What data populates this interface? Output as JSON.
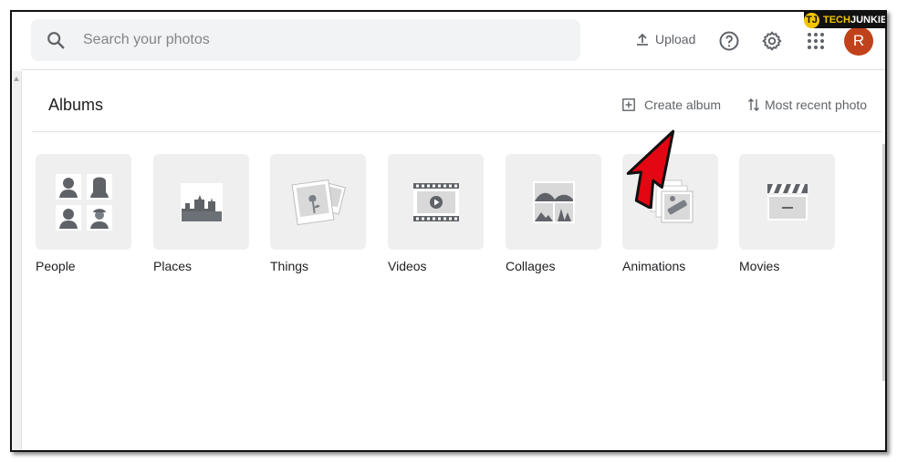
{
  "search": {
    "placeholder": "Search your photos"
  },
  "header": {
    "upload_label": "Upload",
    "avatar_initial": "R"
  },
  "watermark": {
    "badge": "TJ",
    "part1": "TECH",
    "part2": "JUNKIE"
  },
  "albums": {
    "title": "Albums",
    "create_label": "Create album",
    "sort_label": "Most recent photo",
    "items": [
      {
        "label": "People",
        "icon": "people-icon"
      },
      {
        "label": "Places",
        "icon": "places-icon"
      },
      {
        "label": "Things",
        "icon": "things-icon"
      },
      {
        "label": "Videos",
        "icon": "videos-icon"
      },
      {
        "label": "Collages",
        "icon": "collages-icon"
      },
      {
        "label": "Animations",
        "icon": "animations-icon"
      },
      {
        "label": "Movies",
        "icon": "movies-icon"
      }
    ]
  },
  "colors": {
    "accent": "#c0421b",
    "annotation_arrow": "#e30613"
  }
}
